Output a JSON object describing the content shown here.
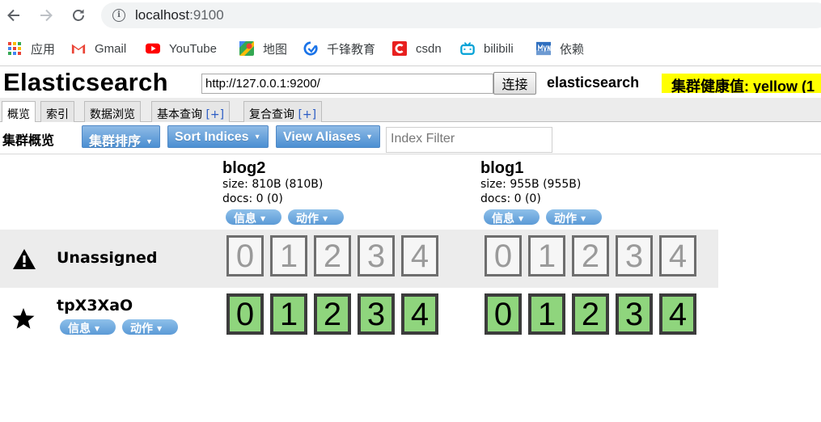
{
  "browser": {
    "url_host": "localhost",
    "url_port": ":9100",
    "bookmarks": [
      {
        "label": "应用",
        "icon": "apps-grid-icon"
      },
      {
        "label": "Gmail",
        "icon": "gmail-icon"
      },
      {
        "label": "YouTube",
        "icon": "youtube-icon"
      },
      {
        "label": "地图",
        "icon": "maps-icon"
      },
      {
        "label": "千锋教育",
        "icon": "qianfeng-icon"
      },
      {
        "label": "csdn",
        "icon": "csdn-icon"
      },
      {
        "label": "bilibili",
        "icon": "bilibili-icon"
      },
      {
        "label": "依赖",
        "icon": "mvn-icon"
      }
    ]
  },
  "header": {
    "title": "Elasticsearch",
    "connect_url": "http://127.0.0.1:9200/",
    "connect_label": "连接",
    "cluster_name": "elasticsearch",
    "health_text": "集群健康值: yellow (1",
    "health_color": "#ffff00"
  },
  "tabs": [
    {
      "label": "概览",
      "active": true
    },
    {
      "label": "索引",
      "active": false
    },
    {
      "label": "数据浏览",
      "active": false
    },
    {
      "label": "基本查询",
      "plus": "[+]",
      "active": false
    },
    {
      "label": "复合查询",
      "plus": "[+]",
      "active": false
    }
  ],
  "toolbar": {
    "title": "集群概览",
    "sort_cluster_label": "集群排序",
    "sort_indices_label": "Sort Indices",
    "view_aliases_label": "View Aliases",
    "filter_placeholder": "Index Filter"
  },
  "indices": [
    {
      "name": "blog2",
      "size": "size: 810B (810B)",
      "docs": "docs: 0 (0)",
      "info_label": "信息",
      "action_label": "动作"
    },
    {
      "name": "blog1",
      "size": "size: 955B (955B)",
      "docs": "docs: 0 (0)",
      "info_label": "信息",
      "action_label": "动作"
    }
  ],
  "rows": {
    "unassigned": {
      "label": "Unassigned",
      "icon": "warning-icon",
      "shards": [
        "0",
        "1",
        "2",
        "3",
        "4"
      ],
      "status": "unassigned"
    },
    "node": {
      "label": "tpX3XaO",
      "icon": "star-icon",
      "info_label": "信息",
      "action_label": "动作",
      "shards": [
        "0",
        "1",
        "2",
        "3",
        "4"
      ],
      "status": "started"
    }
  },
  "colors": {
    "started_shard": "#8fd57d",
    "unassigned_shard": "#f6f6f6",
    "button_blue": "#5b9ad6"
  }
}
